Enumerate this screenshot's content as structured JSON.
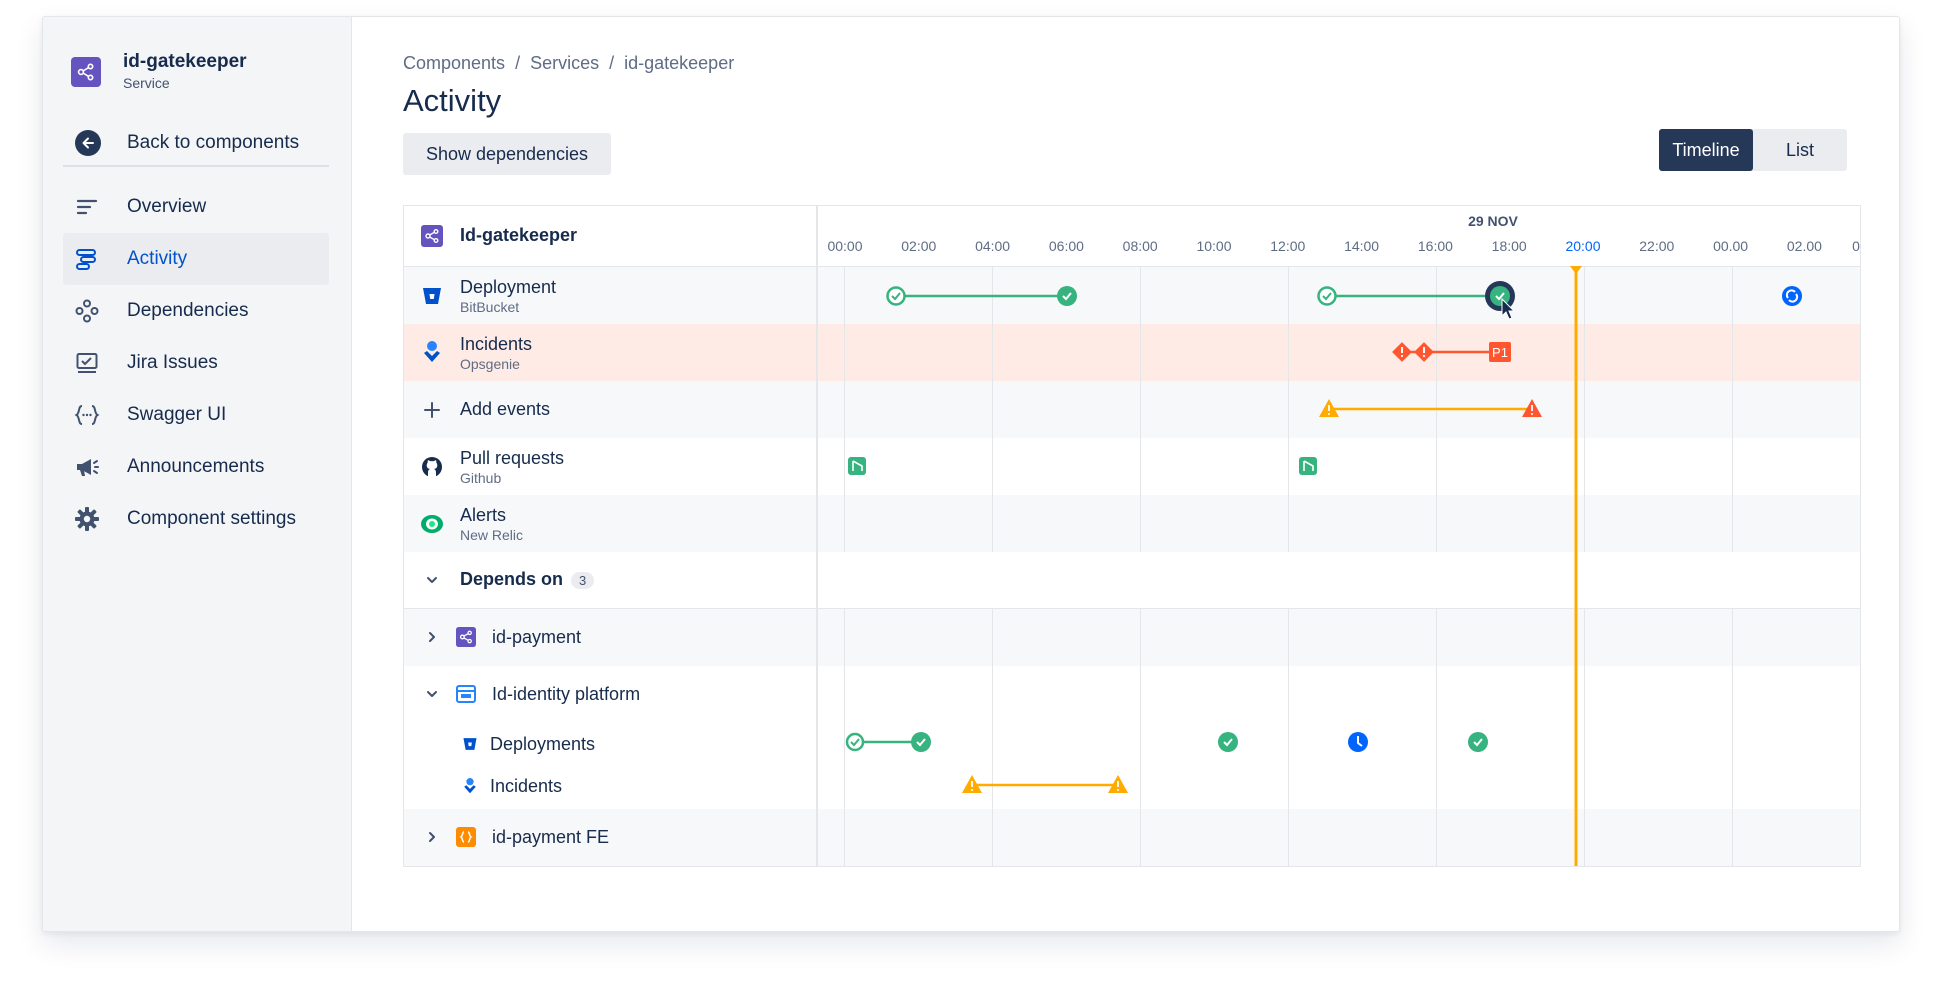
{
  "sidebar": {
    "service_name": "id-gatekeeper",
    "service_type": "Service",
    "back_label": "Back to components",
    "items": [
      {
        "label": "Overview",
        "icon": "overview-icon",
        "active": false
      },
      {
        "label": "Activity",
        "icon": "activity-icon",
        "active": true
      },
      {
        "label": "Dependencies",
        "icon": "dependencies-icon",
        "active": false
      },
      {
        "label": "Jira Issues",
        "icon": "jira-issues-icon",
        "active": false
      },
      {
        "label": "Swagger UI",
        "icon": "swagger-icon",
        "active": false
      },
      {
        "label": "Announcements",
        "icon": "megaphone-icon",
        "active": false
      },
      {
        "label": "Component settings",
        "icon": "gear-icon",
        "active": false
      }
    ]
  },
  "breadcrumb": [
    "Components",
    "Services",
    "id-gatekeeper"
  ],
  "page_title": "Activity",
  "show_deps_label": "Show dependencies",
  "view_toggle": {
    "timeline": "Timeline",
    "list": "List",
    "selected": "Timeline"
  },
  "timeline": {
    "header_title": "Id-gatekeeper",
    "date_label": "29 NOV",
    "ticks": [
      "00:00",
      "02:00",
      "04:00",
      "06:00",
      "08:00",
      "10:00",
      "12:00",
      "14:00",
      "16:00",
      "18:00",
      "20:00",
      "22:00",
      "00.00",
      "02.00",
      "0"
    ],
    "now_tick": "20:00",
    "rows": [
      {
        "title": "Deployment",
        "subtitle": "BitBucket",
        "icon": "bitbucket-icon"
      },
      {
        "title": "Incidents",
        "subtitle": "Opsgenie",
        "icon": "opsgenie-icon",
        "highlighted": true
      },
      {
        "title": "Add events",
        "icon": "plus-icon"
      },
      {
        "title": "Pull requests",
        "subtitle": "Github",
        "icon": "github-icon"
      },
      {
        "title": "Alerts",
        "subtitle": "New Relic",
        "icon": "newrelic-icon"
      }
    ],
    "depends_on": {
      "label": "Depends on",
      "count": "3"
    },
    "dependencies": [
      {
        "name": "id-payment",
        "expanded": false,
        "icon": "service-icon"
      },
      {
        "name": "Id-identity platform",
        "expanded": true,
        "icon": "platform-icon",
        "children": [
          {
            "name": "Deployments",
            "icon": "bitbucket-icon"
          },
          {
            "name": "Incidents",
            "icon": "opsgenie-icon"
          }
        ]
      },
      {
        "name": "id-payment FE",
        "expanded": false,
        "icon": "frontend-icon"
      }
    ],
    "incident_label": "P1"
  },
  "colors": {
    "accent": "#0052cc",
    "success": "#36b37e",
    "danger": "#ff5630",
    "warning": "#ffab00",
    "now_line": "#ffab00",
    "incident_row_bg": "#ffebe6",
    "service_icon": "#6554c0"
  }
}
